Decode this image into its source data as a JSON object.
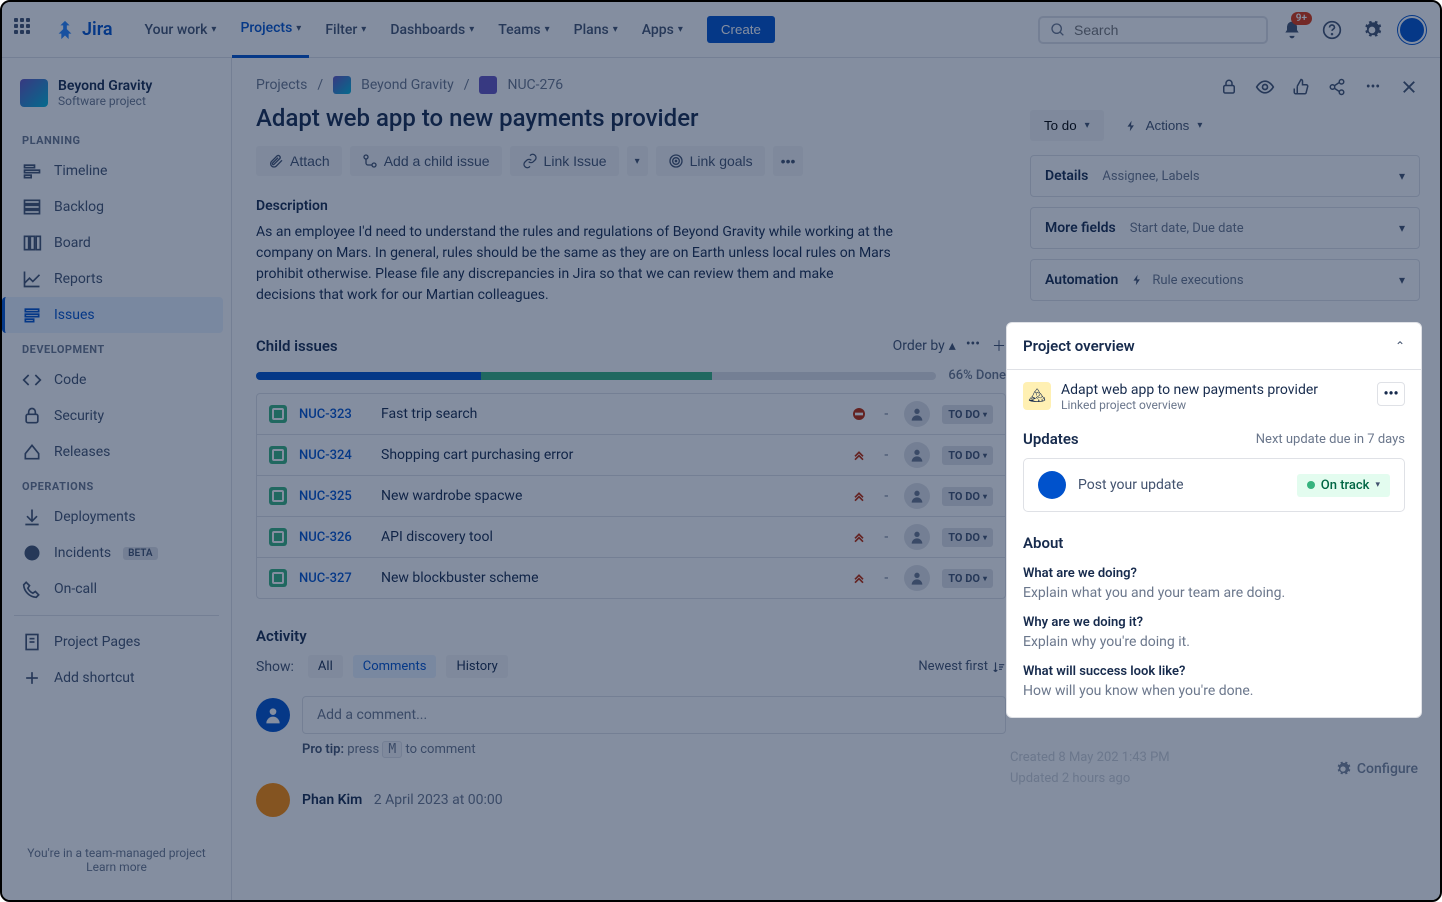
{
  "topnav": {
    "logo": "Jira",
    "items": [
      "Your work",
      "Projects",
      "Filter",
      "Dashboards",
      "Teams",
      "Plans",
      "Apps"
    ],
    "active": 1,
    "create": "Create",
    "search_placeholder": "Search",
    "notif_badge": "9+"
  },
  "sidebar": {
    "project_name": "Beyond Gravity",
    "project_type": "Software project",
    "sections": {
      "planning": {
        "label": "PLANNING",
        "items": [
          "Timeline",
          "Backlog",
          "Board",
          "Reports",
          "Issues"
        ],
        "active": 4
      },
      "development": {
        "label": "DEVELOPMENT",
        "items": [
          "Code",
          "Security",
          "Releases"
        ]
      },
      "operations": {
        "label": "OPERATIONS",
        "items": [
          "Deployments",
          "Incidents",
          "On-call"
        ],
        "beta_index": 1,
        "beta_label": "BETA"
      }
    },
    "footer_items": [
      "Project Pages",
      "Add shortcut"
    ],
    "footer_text": "You're in a team-managed project",
    "footer_link": "Learn more"
  },
  "breadcrumb": {
    "root": "Projects",
    "project": "Beyond Gravity",
    "issue": "NUC-276"
  },
  "issue": {
    "title": "Adapt web app to new payments provider",
    "toolbar": {
      "attach": "Attach",
      "add_child": "Add a child issue",
      "link_issue": "Link Issue",
      "link_goals": "Link goals"
    },
    "description_label": "Description",
    "description": "As an employee I'd need to understand the rules and regulations of Beyond Gravity while working at the company on Mars. In general, rules should be the same as they are on Earth unless local rules on Mars prohibit otherwise. Please file any discrepancies in Jira so that we can review them and make decisions that work for our Martian colleagues.",
    "child_label": "Child issues",
    "order_by": "Order by",
    "progress_text": "66% Done",
    "progress_done_pct": 33,
    "progress_inprog_pct": 34,
    "children": [
      {
        "key": "NUC-323",
        "summary": "Fast trip search",
        "priority": "blocker",
        "status": "TO DO"
      },
      {
        "key": "NUC-324",
        "summary": "Shopping cart purchasing error",
        "priority": "highest",
        "status": "TO DO"
      },
      {
        "key": "NUC-325",
        "summary": "New wardrobe spacwe",
        "priority": "highest",
        "status": "TO DO"
      },
      {
        "key": "NUC-326",
        "summary": "API discovery tool",
        "priority": "highest",
        "status": "TO DO"
      },
      {
        "key": "NUC-327",
        "summary": "New blockbuster scheme",
        "priority": "highest",
        "status": "TO DO"
      }
    ],
    "activity_label": "Activity",
    "activity_show": "Show:",
    "activity_tabs": [
      "All",
      "Comments",
      "History"
    ],
    "activity_tab_active": 1,
    "activity_sort": "Newest first",
    "comment_placeholder": "Add a comment...",
    "pro_tip_label": "Pro tip:",
    "pro_tip_press": "press",
    "pro_tip_key": "M",
    "pro_tip_rest": "to comment",
    "comments": [
      {
        "author": "Phan Kim",
        "date": "2 April 2023 at 00:00"
      }
    ]
  },
  "right": {
    "status": "To do",
    "actions": "Actions",
    "details": {
      "title": "Details",
      "sub": "Assignee, Labels"
    },
    "more_fields": {
      "title": "More fields",
      "sub": "Start date, Due date"
    },
    "automation": {
      "title": "Automation",
      "sub": "Rule executions"
    }
  },
  "overview": {
    "heading": "Project overview",
    "linked_title": "Adapt web app to new payments provider",
    "linked_sub": "Linked project overview",
    "updates_label": "Updates",
    "updates_due": "Next update due in 7 days",
    "post_placeholder": "Post your update",
    "track_label": "On track",
    "about_label": "About",
    "q1": "What are we doing?",
    "a1": "Explain what you and your team are doing.",
    "q2": "Why are we doing it?",
    "a2": "Explain why you're doing it.",
    "q3": "What will success look like?",
    "a3": "How will you know when you're done.",
    "created": "Created 8 May 202 1:43 PM",
    "updated": "Updated 2 hours ago",
    "configure": "Configure"
  }
}
